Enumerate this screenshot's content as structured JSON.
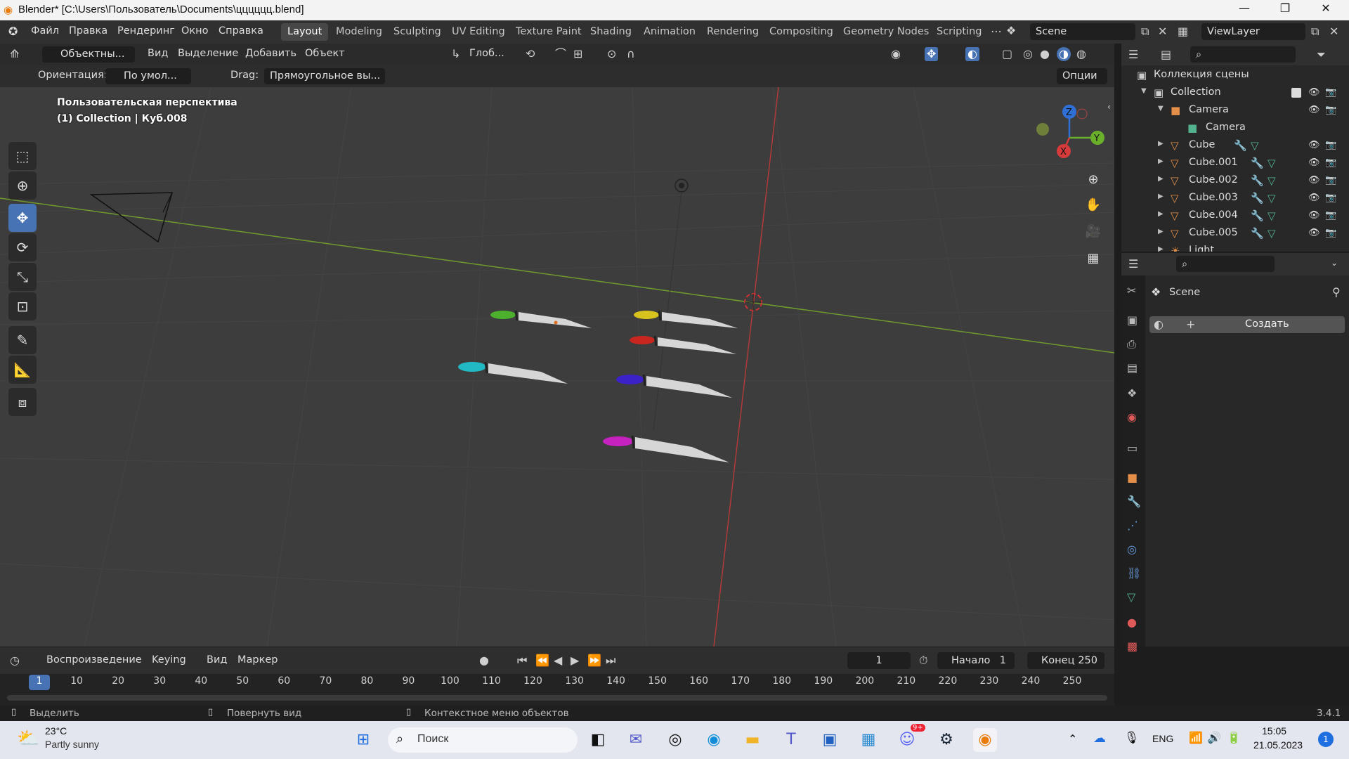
{
  "window": {
    "title": "Blender* [C:\\Users\\Пользователь\\Documents\\цццццц.blend]",
    "minimize": "—",
    "maximize": "❐",
    "close": "✕"
  },
  "menu": {
    "items": [
      "Файл",
      "Правка",
      "Рендеринг",
      "Окно",
      "Справка"
    ],
    "workspaces": [
      "Layout",
      "Modeling",
      "Sculpting",
      "UV Editing",
      "Texture Paint",
      "Shading",
      "Animation",
      "Rendering",
      "Compositing",
      "Geometry Nodes",
      "Scripting"
    ],
    "active_workspace": "Layout",
    "scene": "Scene",
    "view_layer": "ViewLayer"
  },
  "viewport_header": {
    "mode": "Объектны...",
    "menus": [
      "Вид",
      "Выделение",
      "Добавить",
      "Объект"
    ],
    "transform": "Глоб...",
    "orientation_label": "Ориентация:",
    "orientation_value": "По умол...",
    "drag_label": "Drag:",
    "drag_value": "Прямоугольное вы...",
    "options": "Опции"
  },
  "viewport": {
    "overlay_view": "Пользовательская перспектива",
    "overlay_object": "(1) Collection | Куб.008",
    "gizmo": {
      "z": "Z",
      "y": "Y",
      "x": "X"
    },
    "knives": [
      {
        "handle": "#4caf2e",
        "label": "green"
      },
      {
        "handle": "#d8c21e",
        "label": "yellow"
      },
      {
        "handle": "#c8261f",
        "label": "red"
      },
      {
        "handle": "#22b8c4",
        "label": "cyan"
      },
      {
        "handle": "#3a22c8",
        "label": "blue"
      },
      {
        "handle": "#c622c0",
        "label": "magenta"
      }
    ]
  },
  "outliner": {
    "scene_collection": "Коллекция сцены",
    "rows": [
      {
        "name": "Collection",
        "type": "collection"
      },
      {
        "name": "Camera",
        "type": "camera-object"
      },
      {
        "name": "Camera",
        "type": "camera-data"
      },
      {
        "name": "Cube",
        "type": "mesh"
      },
      {
        "name": "Cube.001",
        "type": "mesh"
      },
      {
        "name": "Cube.002",
        "type": "mesh"
      },
      {
        "name": "Cube.003",
        "type": "mesh"
      },
      {
        "name": "Cube.004",
        "type": "mesh"
      },
      {
        "name": "Cube.005",
        "type": "mesh"
      },
      {
        "name": "Light",
        "type": "light"
      }
    ]
  },
  "properties": {
    "scene": "Scene",
    "create": "Создать",
    "tabs": [
      "tool",
      "render",
      "output",
      "view-layer",
      "scene",
      "world",
      "collection",
      "object",
      "modifiers",
      "particles",
      "physics",
      "constraints",
      "data",
      "material",
      "texture"
    ]
  },
  "timeline": {
    "menus": [
      "Воспроизведение",
      "Keying",
      "Вид",
      "Маркер"
    ],
    "current_frame": "1",
    "start_label": "Начало",
    "start": "1",
    "end_label": "Конец",
    "end": "250",
    "ticks": [
      "1",
      "10",
      "20",
      "30",
      "40",
      "50",
      "60",
      "70",
      "80",
      "90",
      "100",
      "110",
      "120",
      "130",
      "140",
      "150",
      "160",
      "170",
      "180",
      "190",
      "200",
      "210",
      "220",
      "230",
      "240",
      "250"
    ]
  },
  "statusbar": {
    "select": "Выделить",
    "rotate": "Повернуть вид",
    "context": "Контекстное меню объектов",
    "version": "3.4.1"
  },
  "taskbar": {
    "weather_temp": "23°C",
    "weather_desc": "Partly sunny",
    "search": "Поиск",
    "lang": "ENG",
    "time": "15:05",
    "date": "21.05.2023",
    "notifications": "1",
    "discord_badge": "9+"
  }
}
